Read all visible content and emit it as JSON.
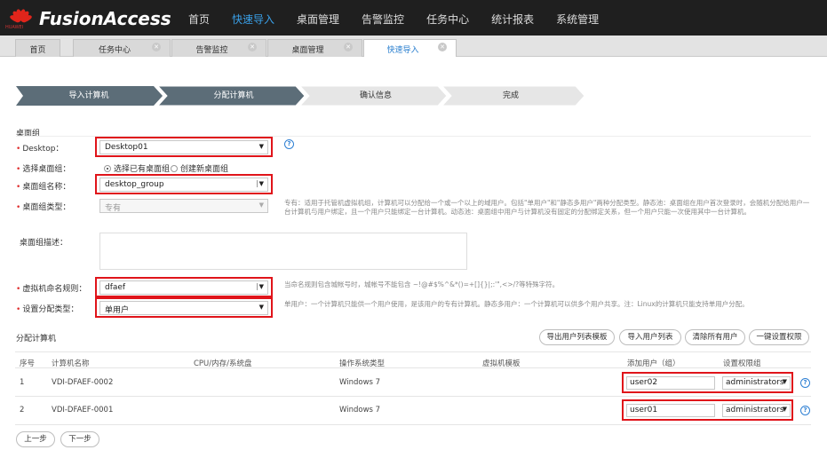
{
  "app": {
    "brand": "FusionAccess",
    "brand_sub": "HUAWEI"
  },
  "nav": [
    "首页",
    "快速导入",
    "桌面管理",
    "告警监控",
    "任务中心",
    "统计报表",
    "系统管理"
  ],
  "tabs": [
    "首页",
    "任务中心",
    "告警监控",
    "桌面管理",
    "快速导入"
  ],
  "steps": [
    "导入计算机",
    "分配计算机",
    "确认信息",
    "完成"
  ],
  "section_desktop_group": "桌面组",
  "form": {
    "desktop_label": "Desktop：",
    "desktop_value": "Desktop01",
    "select_group_label": "选择桌面组：",
    "radio_existing": "选择已有桌面组",
    "radio_new": "创建新桌面组",
    "group_name_label": "桌面组名称：",
    "group_name_value": "desktop_group",
    "group_type_label": "桌面组类型：",
    "group_type_value": "专有",
    "group_type_hint": "专有：适用于托管机虚拟机组，计算机可以分配给一个或一个以上的域用户。包括\"单用户\"和\"静态多用户\"两种分配类型。静态池：桌面组在用户首次登录时，会随机分配给用户一台计算机与用户绑定，且一个用户只能绑定一台计算机。动态池：桌面组中用户与计算机没有固定的分配绑定关系，但一个用户只能一次使用其中一台计算机。",
    "group_desc_label": "桌面组描述：",
    "vm_naming_label": "虚拟机命名规则：",
    "vm_naming_value": "dfaef",
    "vm_naming_hint": "当命名规则包含城帐号时，城帐号不能包含 ~!@#$%^&*()=+[]{}|;:'\",<>/?等特殊字符。",
    "assign_type_label": "设置分配类型：",
    "assign_type_value": "单用户",
    "assign_type_hint": "单用户：一个计算机只能供一个用户使用，是该用户的专有计算机。静态多用户：一个计算机可以供多个用户共享。注：Linux的计算机只能支持单用户分配。"
  },
  "section_assign": "分配计算机",
  "buttons": {
    "export": "导出用户列表模板",
    "import": "导入用户列表",
    "clear": "清除所有用户",
    "set_perm": "一键设置权限",
    "prev": "上一步",
    "next": "下一步"
  },
  "table": {
    "headers": [
      "序号",
      "计算机名称",
      "CPU/内存/系统盘",
      "操作系统类型",
      "虚拟机模板",
      "添加用户（组）",
      "设置权限组"
    ],
    "rows": [
      {
        "no": "1",
        "name": "VDI-DFAEF-0002",
        "cpu": "",
        "os": "Windows 7",
        "template": "",
        "user": "user02",
        "perm": "administrators"
      },
      {
        "no": "2",
        "name": "VDI-DFAEF-0001",
        "cpu": "",
        "os": "Windows 7",
        "template": "",
        "user": "user01",
        "perm": "administrators"
      }
    ]
  },
  "colors": {
    "topbar": "#1f1f1f",
    "accent": "#3aa0e8",
    "step_active": "#5c6d78",
    "highlight": "#e0141a",
    "required": "#e03131"
  }
}
